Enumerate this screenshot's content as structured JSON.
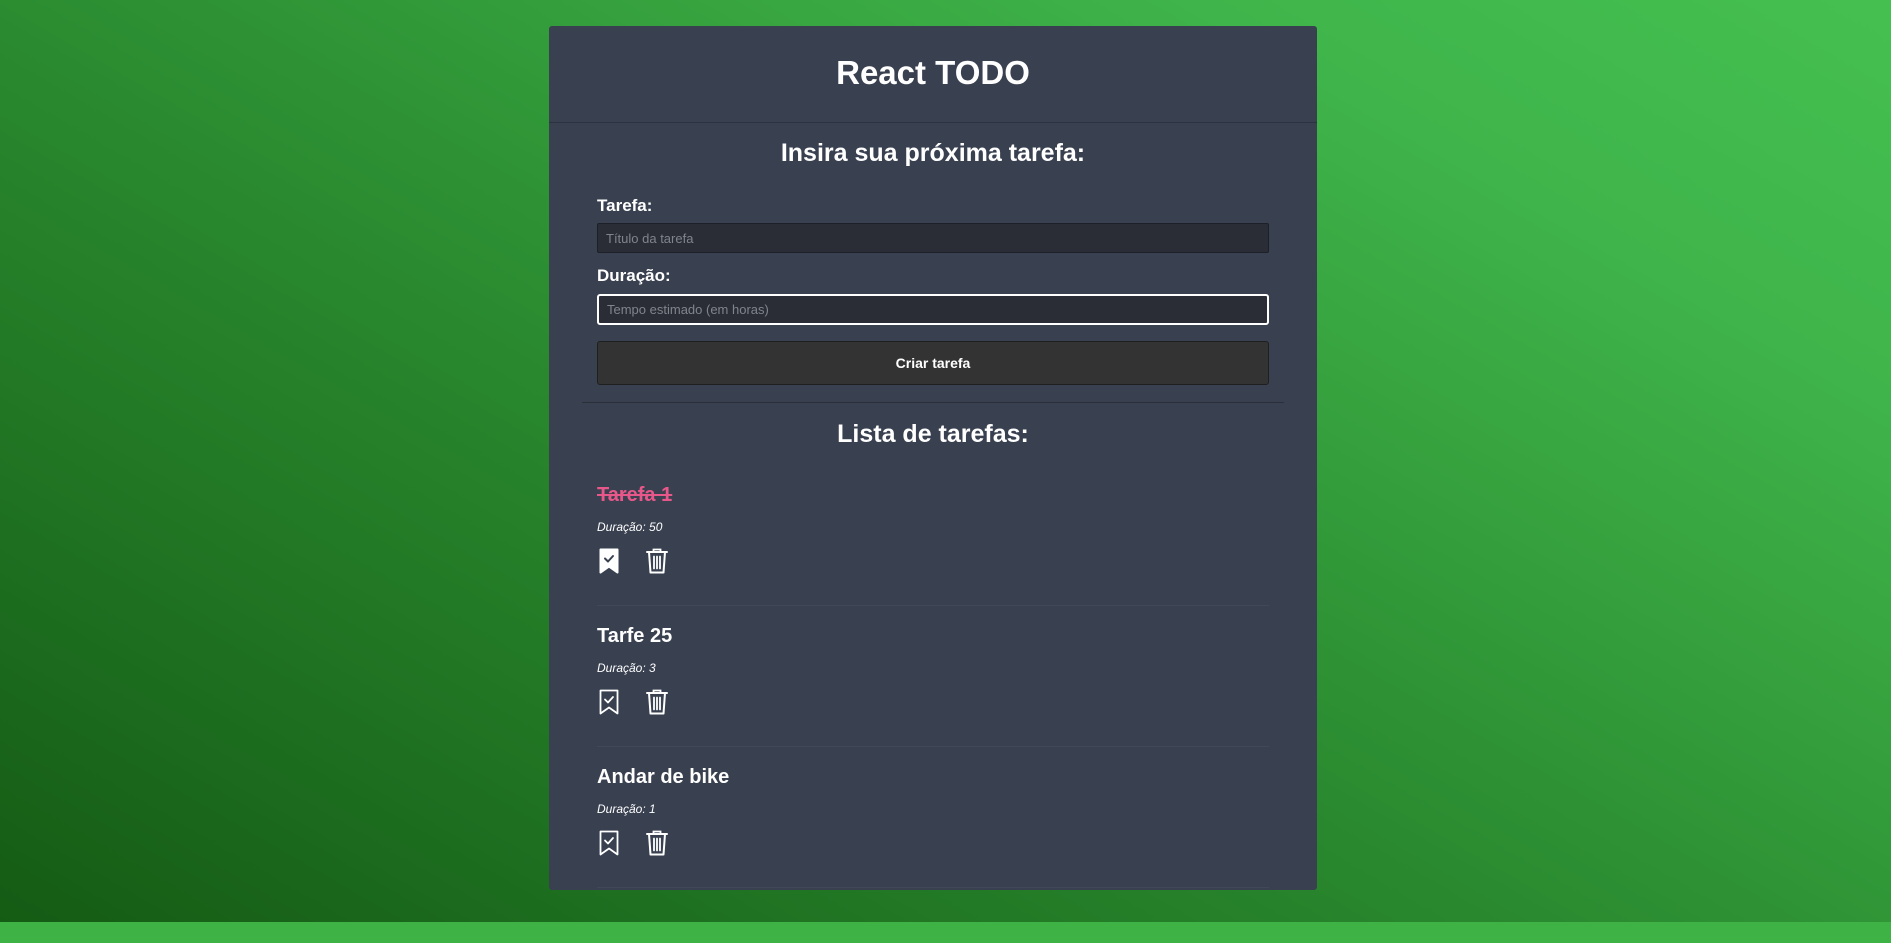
{
  "app": {
    "title": "React TODO"
  },
  "form": {
    "heading": "Insira sua próxima tarefa:",
    "task_label": "Tarefa:",
    "task_placeholder": "Título da tarefa",
    "task_value": "",
    "duration_label": "Duração:",
    "duration_placeholder": "Tempo estimado (em horas)",
    "duration_value": "",
    "submit_label": "Criar tarefa"
  },
  "list": {
    "heading": "Lista de tarefas:",
    "items": [
      {
        "title": "Tarefa 1",
        "duration_text": "Duração: 50",
        "done": true,
        "complete_icon": "bookmark-check-filled-icon",
        "delete_icon": "trash-icon"
      },
      {
        "title": "Tarfe 25",
        "duration_text": "Duração: 3",
        "done": false,
        "complete_icon": "bookmark-check-icon",
        "delete_icon": "trash-icon"
      },
      {
        "title": "Andar de bike",
        "duration_text": "Duração: 1",
        "done": false,
        "complete_icon": "bookmark-check-icon",
        "delete_icon": "trash-icon"
      }
    ]
  },
  "colors": {
    "card_background": "#394050",
    "done_title": "#e8578a",
    "input_background": "#2a2d35",
    "button_background": "#333333"
  }
}
